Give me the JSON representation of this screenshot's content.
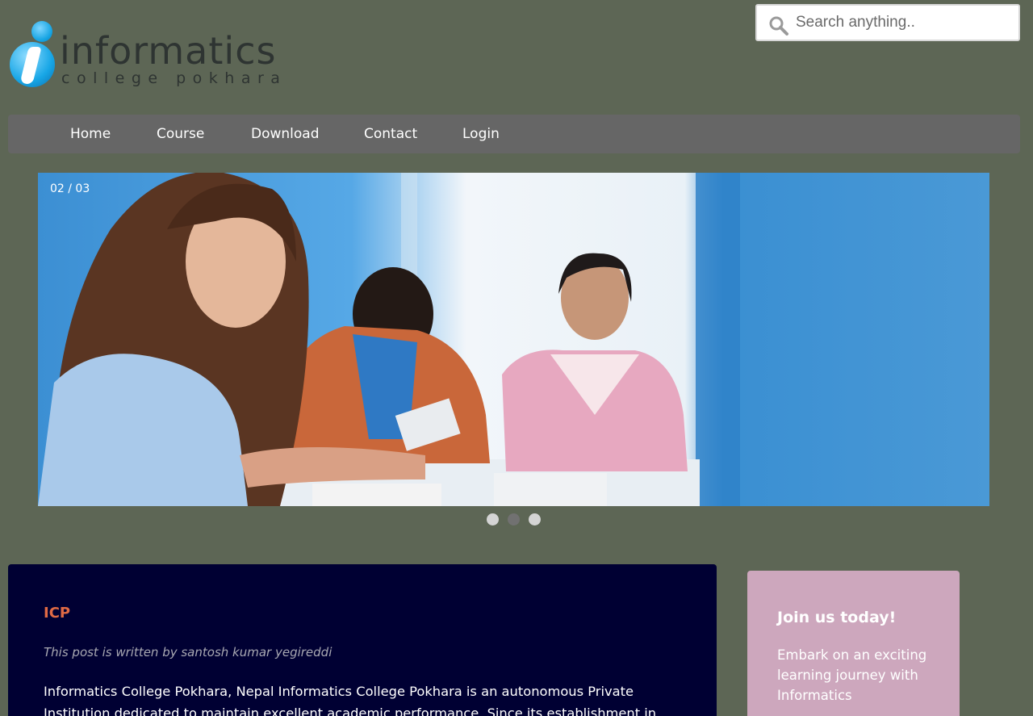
{
  "logo": {
    "word": "informatics",
    "subtitle": "college pokhara"
  },
  "search": {
    "placeholder": "Search anything..",
    "icon": "search-icon"
  },
  "nav": {
    "items": [
      {
        "label": "Home"
      },
      {
        "label": "Course"
      },
      {
        "label": "Download"
      },
      {
        "label": "Contact"
      },
      {
        "label": "Login"
      }
    ]
  },
  "slider": {
    "counter": "02 / 03",
    "dots": [
      {
        "active": false
      },
      {
        "active": true
      },
      {
        "active": false
      }
    ]
  },
  "post": {
    "title": "ICP",
    "byline": "This post is written by santosh kumar yegireddi",
    "body": "Informatics College Pokhara, Nepal Informatics College Pokhara is an autonomous Private Institution dedicated to maintain excellent academic performance. Since its establishment in"
  },
  "join": {
    "title": "Join us today!",
    "text": "Embark on an exciting learning journey with Informatics"
  },
  "colors": {
    "background": "#5d6655",
    "nav": "#666666",
    "card": "#000033",
    "title_accent": "#e06a45",
    "join_box": "#cda7bd"
  }
}
